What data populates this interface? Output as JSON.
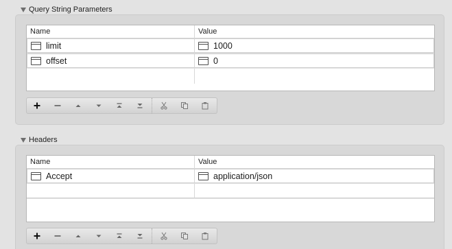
{
  "sections": {
    "query": {
      "title": "Query String Parameters",
      "columns": {
        "name": "Name",
        "value": "Value"
      },
      "rows": [
        {
          "name": "limit",
          "value": "1000"
        },
        {
          "name": "offset",
          "value": "0"
        }
      ]
    },
    "headers": {
      "title": "Headers",
      "columns": {
        "name": "Name",
        "value": "Value"
      },
      "rows": [
        {
          "name": "Accept",
          "value": "application/json"
        }
      ]
    }
  },
  "toolbar_icons": [
    "plus-icon",
    "minus-icon",
    "move-up-icon",
    "move-down-icon",
    "move-to-top-icon",
    "move-to-bottom-icon",
    "cut-icon",
    "copy-icon",
    "paste-icon"
  ],
  "colors": {
    "background": "#e3e3e3",
    "panel": "#d8d8d8",
    "table_bg": "#ffffff",
    "icon": "#4a4a4a"
  }
}
